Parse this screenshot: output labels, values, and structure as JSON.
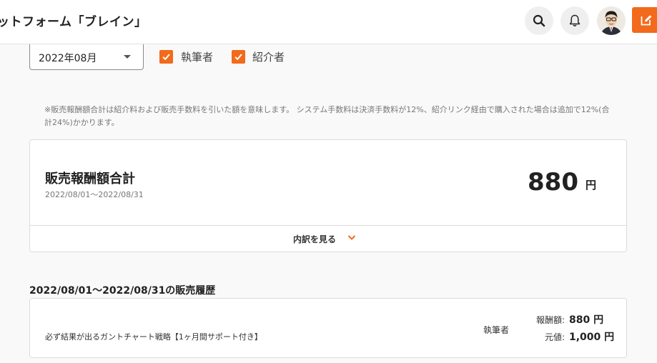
{
  "header": {
    "title": "ットフォーム「ブレイン」"
  },
  "filters": {
    "month": "2022年08月",
    "author_label": "執筆者",
    "referrer_label": "紹介者",
    "author_checked": true,
    "referrer_checked": true
  },
  "note": "※販売報酬額合計は紹介料および販売手数料を引いた額を意味します。 システム手数料は決済手数料が12%、紹介リンク経由で購入された場合は追加で12%(合計24%)かかります。",
  "summary": {
    "title": "販売報酬額合計",
    "period": "2022/08/01～2022/08/31",
    "amount": "880",
    "unit": "円",
    "breakdown_label": "内訳を見る"
  },
  "history": {
    "title": "2022/08/01～2022/08/31の販売履歴",
    "items": [
      {
        "name": "必ず結果が出るガントチャート戦略【1ヶ月間サポート付き】",
        "role": "執筆者",
        "reward_label": "報酬額:",
        "reward_value": "880 円",
        "price_label": "元値:",
        "price_value": "1,000 円"
      }
    ]
  },
  "colors": {
    "accent": "#f26a1b"
  }
}
